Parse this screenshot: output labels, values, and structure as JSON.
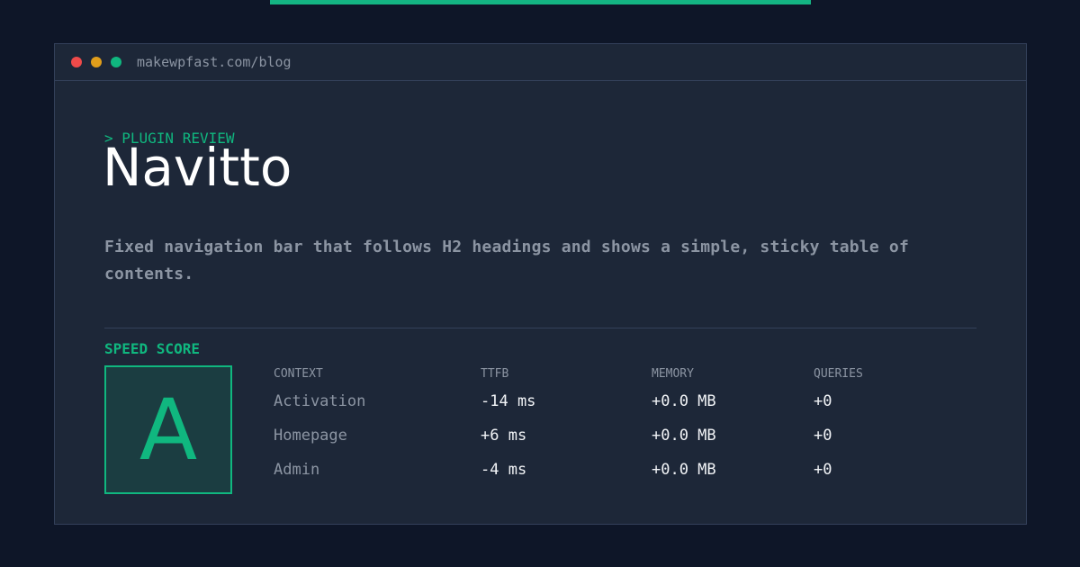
{
  "browser": {
    "url": "makewpfast.com/blog"
  },
  "hero": {
    "eyebrow": "> PLUGIN REVIEW",
    "title": "Navitto",
    "description": "Fixed navigation bar that follows H2 headings and shows a simple, sticky table of contents."
  },
  "score": {
    "label": "SPEED SCORE",
    "grade": "A"
  },
  "metrics": {
    "headers": {
      "context": "CONTEXT",
      "ttfb": "TTFB",
      "memory": "MEMORY",
      "queries": "QUERIES"
    },
    "rows": [
      {
        "context": "Activation",
        "ttfb": "-14 ms",
        "memory": "+0.0 MB",
        "queries": "+0"
      },
      {
        "context": "Homepage",
        "ttfb": "+6 ms",
        "memory": "+0.0 MB",
        "queries": "+0"
      },
      {
        "context": "Admin",
        "ttfb": "-4 ms",
        "memory": "+0.0 MB",
        "queries": "+0"
      }
    ]
  },
  "colors": {
    "background": "#0e1628",
    "panel": "#1d2738",
    "accent": "#10b77f",
    "muted_text": "#8c95a3",
    "text": "#f2f4f7",
    "dot_red": "#ef4a4a",
    "dot_yellow": "#e09e1b",
    "dot_green": "#10b77f"
  }
}
